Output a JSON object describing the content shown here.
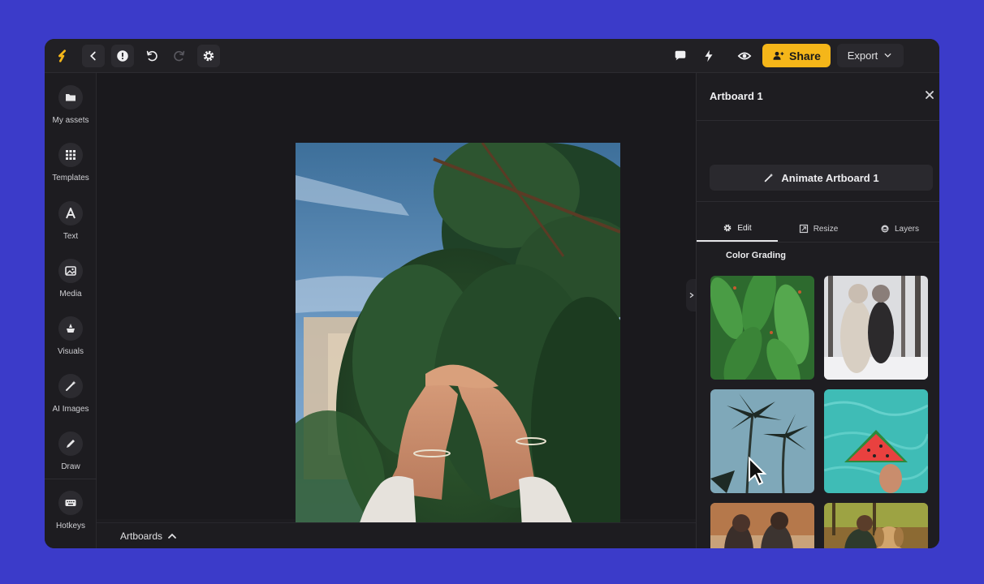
{
  "toolbar": {
    "share_label": "Share",
    "export_label": "Export"
  },
  "sidebar": {
    "items": [
      {
        "label": "My assets",
        "icon": "folder-icon"
      },
      {
        "label": "Templates",
        "icon": "grid-icon"
      },
      {
        "label": "Text",
        "icon": "text-icon"
      },
      {
        "label": "Media",
        "icon": "image-icon"
      },
      {
        "label": "Visuals",
        "icon": "shapes-icon"
      },
      {
        "label": "AI Images",
        "icon": "magic-wand-icon"
      },
      {
        "label": "Draw",
        "icon": "pencil-icon"
      },
      {
        "label": "Hotkeys",
        "icon": "keyboard-icon"
      }
    ]
  },
  "bottom_bar": {
    "artboards_label": "Artboards"
  },
  "panel": {
    "title": "Artboard 1",
    "animate_label": "Animate Artboard 1",
    "tabs": [
      {
        "label": "Edit",
        "icon": "gear-icon",
        "active": true
      },
      {
        "label": "Resize",
        "icon": "resize-icon",
        "active": false
      },
      {
        "label": "Layers",
        "icon": "layers-icon",
        "active": false
      }
    ],
    "section_title": "Color Grading",
    "presets": [
      "cactus",
      "winter-couple",
      "palm-trees",
      "watermelon",
      "autumn-friends",
      "dog-in-leaves"
    ]
  },
  "colors": {
    "accent": "#f5b619",
    "background": "#3b3bc9",
    "panel": "#1e1d21",
    "canvas": "#1a191d"
  }
}
